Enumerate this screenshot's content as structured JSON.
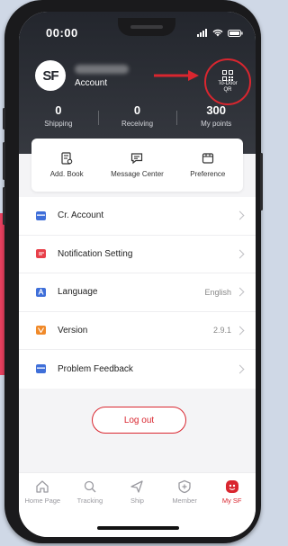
{
  "status_bar": {
    "time": "00:00"
  },
  "account": {
    "logo_text": "SF",
    "label": "Account",
    "qr_line1": "To-Door",
    "qr_line2": "QR"
  },
  "stats": [
    {
      "value": "0",
      "label": "Shipping"
    },
    {
      "value": "0",
      "label": "Receiving"
    },
    {
      "value": "300",
      "label": "My points"
    }
  ],
  "quick_actions": [
    {
      "label": "Add. Book",
      "icon": "address-book-icon"
    },
    {
      "label": "Message Center",
      "icon": "message-icon"
    },
    {
      "label": "Preference",
      "icon": "preference-icon"
    }
  ],
  "menu": [
    {
      "label": "Cr. Account",
      "value": "",
      "icon": "credit-card-icon",
      "color": "#3f6fd9"
    },
    {
      "label": "Notification Setting",
      "value": "",
      "icon": "notification-icon",
      "color": "#e8404a"
    },
    {
      "label": "Language",
      "value": "English",
      "icon": "language-icon",
      "color": "#3f6fd9"
    },
    {
      "label": "Version",
      "value": "2.9.1",
      "icon": "version-icon",
      "color": "#f08a2a"
    },
    {
      "label": "Problem Feedback",
      "value": "",
      "icon": "feedback-icon",
      "color": "#3f6fd9"
    }
  ],
  "logout_label": "Log out",
  "tabs": [
    {
      "label": "Home Page",
      "icon": "home-icon"
    },
    {
      "label": "Tracking",
      "icon": "search-icon"
    },
    {
      "label": "Ship",
      "icon": "send-icon"
    },
    {
      "label": "Member",
      "icon": "member-icon"
    },
    {
      "label": "My SF",
      "icon": "my-sf-icon",
      "active": true
    }
  ],
  "colors": {
    "accent": "#d9262f",
    "header": "#2b2e35"
  }
}
